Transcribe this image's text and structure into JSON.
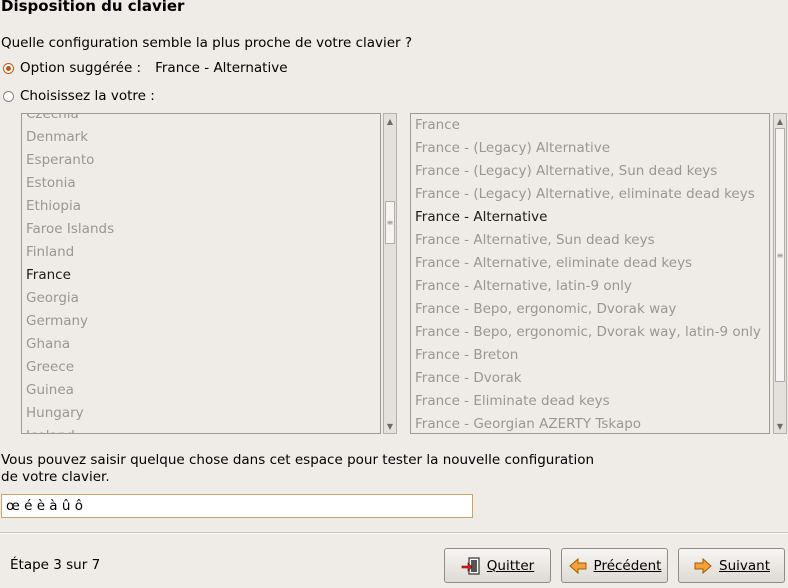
{
  "header": {
    "title": "Disposition du clavier"
  },
  "question": "Quelle configuration semble la plus proche de votre clavier ?",
  "options": {
    "suggested_label": "Option suggérée :",
    "suggested_value": "France - Alternative",
    "custom_label": "Choisissez la votre :"
  },
  "countries": {
    "items": [
      "Czechia",
      "Denmark",
      "Esperanto",
      "Estonia",
      "Ethiopia",
      "Faroe Islands",
      "Finland",
      "France",
      "Georgia",
      "Germany",
      "Ghana",
      "Greece",
      "Guinea",
      "Hungary",
      "Iceland"
    ],
    "selected": "France"
  },
  "variants": {
    "items": [
      "France",
      "France - (Legacy) Alternative",
      "France - (Legacy) Alternative, Sun dead keys",
      "France - (Legacy) Alternative, eliminate dead keys",
      "France - Alternative",
      "France - Alternative, Sun dead keys",
      "France - Alternative, eliminate dead keys",
      "France - Alternative, latin-9 only",
      "France - Bepo, ergonomic, Dvorak way",
      "France - Bepo, ergonomic, Dvorak way, latin-9 only",
      "France - Breton",
      "France - Dvorak",
      "France - Eliminate dead keys",
      "France - Georgian AZERTY Tskapo"
    ],
    "selected": "France - Alternative"
  },
  "test": {
    "hint": "Vous pouvez saisir quelque chose dans cet espace pour tester la nouvelle configuration de votre clavier.",
    "value": "œ é è à û ô"
  },
  "footer": {
    "step": "Étape 3 sur 7",
    "quit_label": "Quitter",
    "back_label": "Précédent",
    "next_label": "Suivant"
  },
  "colors": {
    "accent": "#c2571a",
    "window_bg": "#efebe7",
    "disabled_text": "#9a9792"
  },
  "icons": {
    "quit": "exit-door-icon",
    "back": "left-arrow-icon",
    "next": "right-arrow-icon"
  }
}
